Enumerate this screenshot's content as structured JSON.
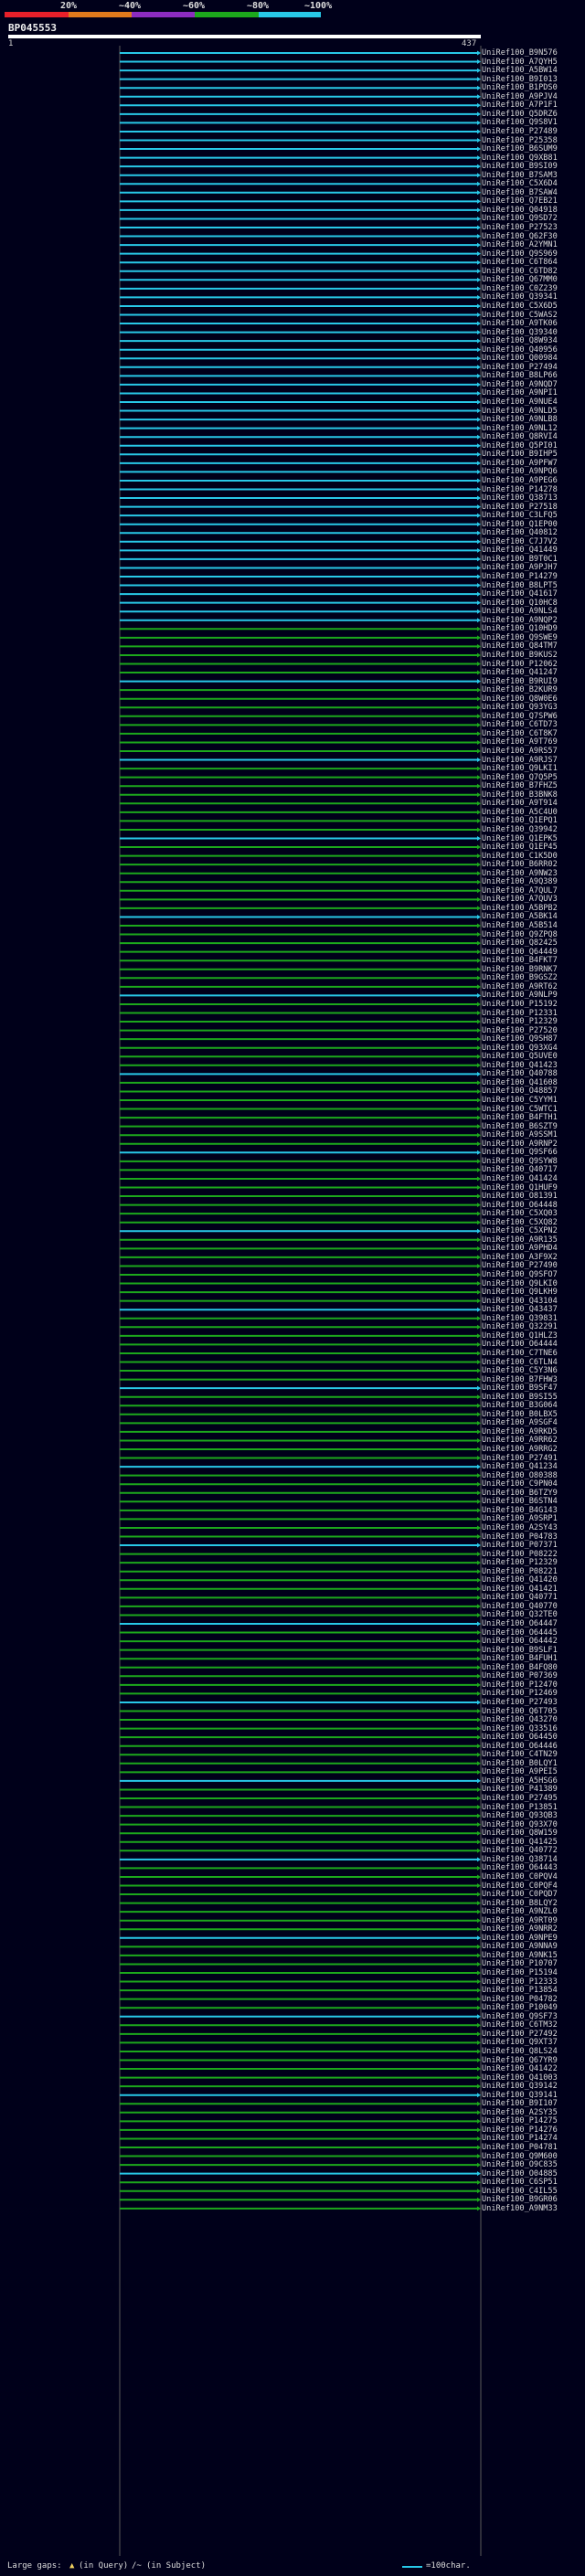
{
  "header": {
    "percent_scale": [
      "20%",
      "~40%",
      "~60%",
      "~80%",
      "~100%"
    ],
    "color_scale": [
      "#e8202a",
      "#e07a1c",
      "#8c2cc0",
      "#1ca81c",
      "#28c8e8"
    ],
    "query_name": "BP045553",
    "start_tick": "1",
    "end_tick": "437"
  },
  "hits": [
    "UniRef100_B9N576",
    "UniRef100_A7QYH5",
    "UniRef100_A5BW14",
    "UniRef100_B9I013",
    "UniRef100_B1PDS0",
    "UniRef100_A9PJV4",
    "UniRef100_A7P1F1",
    "UniRef100_Q5DRZ6",
    "UniRef100_Q9S8V1",
    "UniRef100_P27489",
    "UniRef100_P25358",
    "UniRef100_B6SUM9",
    "UniRef100_Q9XB81",
    "UniRef100_B9SI09",
    "UniRef100_B7SAM3",
    "UniRef100_C5X6D4",
    "UniRef100_B7SAW4",
    "UniRef100_Q7EB21",
    "UniRef100_Q04918",
    "UniRef100_Q9SD72",
    "UniRef100_P27523",
    "UniRef100_Q62F30",
    "UniRef100_A2YMN1",
    "UniRef100_Q9S969",
    "UniRef100_C6T864",
    "UniRef100_C6TD82",
    "UniRef100_Q67MM0",
    "UniRef100_C0Z239",
    "UniRef100_Q39341",
    "UniRef100_C5X6D5",
    "UniRef100_C5WAS2",
    "UniRef100_A9TK06",
    "UniRef100_Q39340",
    "UniRef100_Q8W934",
    "UniRef100_Q40956",
    "UniRef100_Q00984",
    "UniRef100_P27494",
    "UniRef100_B8LP66",
    "UniRef100_A9NQD7",
    "UniRef100_A9NPI1",
    "UniRef100_A9NUE4",
    "UniRef100_A9NLD5",
    "UniRef100_A9NLB8",
    "UniRef100_A9NL12",
    "UniRef100_Q8RVI4",
    "UniRef100_Q5PI01",
    "UniRef100_B9IHP5",
    "UniRef100_A9PFW7",
    "UniRef100_A9NPQ6",
    "UniRef100_A9PEG6",
    "UniRef100_P14278",
    "UniRef100_Q38713",
    "UniRef100_P27518",
    "UniRef100_C3LFQ5",
    "UniRef100_Q1EP00",
    "UniRef100_Q40812",
    "UniRef100_C7J7V2",
    "UniRef100_Q41449",
    "UniRef100_B9T0C1",
    "UniRef100_A9PJH7",
    "UniRef100_P14279",
    "UniRef100_B8LPT5",
    "UniRef100_Q41617",
    "UniRef100_Q10HC8",
    "UniRef100_A9NLS4",
    "UniRef100_A9NQP2",
    "UniRef100_Q10HD9",
    "UniRef100_Q9SWE9",
    "UniRef100_Q84TM7",
    "UniRef100_B9KUS2",
    "UniRef100_P12062",
    "UniRef100_Q41247",
    "UniRef100_B9RUI9",
    "UniRef100_B2KUR9",
    "UniRef100_Q8W0E6",
    "UniRef100_Q93YG3",
    "UniRef100_Q7SPW6",
    "UniRef100_C6TD73",
    "UniRef100_C6T8K7",
    "UniRef100_A9T769",
    "UniRef100_A9RS57",
    "UniRef100_A9RJS7",
    "UniRef100_Q9LKI1",
    "UniRef100_Q7Q5P5",
    "UniRef100_B7FHZ5",
    "UniRef100_B3BNK8",
    "UniRef100_A9T914",
    "UniRef100_A5C4U0",
    "UniRef100_Q1EPQ1",
    "UniRef100_Q39942",
    "UniRef100_Q1EPK5",
    "UniRef100_Q1EP45",
    "UniRef100_C1K5D0",
    "UniRef100_B6RR02",
    "UniRef100_A9NW23",
    "UniRef100_A9Q389",
    "UniRef100_A7QUL7",
    "UniRef100_A7QUV3",
    "UniRef100_A5BPB2",
    "UniRef100_A5BK14",
    "UniRef100_A5B514",
    "UniRef100_Q9ZPQ8",
    "UniRef100_Q82425",
    "UniRef100_Q64449",
    "UniRef100_B4FKT7",
    "UniRef100_B9RNK7",
    "UniRef100_B9GSZ2",
    "UniRef100_A9RT62",
    "UniRef100_A9NLP9",
    "UniRef100_P15192",
    "UniRef100_P12331",
    "UniRef100_P12329",
    "UniRef100_P27520",
    "UniRef100_Q9SH87",
    "UniRef100_Q93XG4",
    "UniRef100_Q5UVE0",
    "UniRef100_Q41423",
    "UniRef100_Q40788",
    "UniRef100_Q41608",
    "UniRef100_O48857",
    "UniRef100_C5YYM1",
    "UniRef100_C5WTC1",
    "UniRef100_B4FTH1",
    "UniRef100_B6SZT9",
    "UniRef100_A9SSM1",
    "UniRef100_A9RNP2",
    "UniRef100_Q9SF66",
    "UniRef100_Q9SYW8",
    "UniRef100_Q40717",
    "UniRef100_Q41424",
    "UniRef100_Q1HUF9",
    "UniRef100_O81391",
    "UniRef100_O64448",
    "UniRef100_C5XQ03",
    "UniRef100_C5XQ82",
    "UniRef100_C5XPN2",
    "UniRef100_A9R135",
    "UniRef100_A9PHD4",
    "UniRef100_A3F9X2",
    "UniRef100_P27490",
    "UniRef100_Q9SFO7",
    "UniRef100_Q9LKI0",
    "UniRef100_Q9LKH9",
    "UniRef100_Q43104",
    "UniRef100_Q43437",
    "UniRef100_Q39831",
    "UniRef100_Q32291",
    "UniRef100_Q1HLZ3",
    "UniRef100_O64444",
    "UniRef100_C7TNE6",
    "UniRef100_C6TLN4",
    "UniRef100_C5Y3N6",
    "UniRef100_B7FHW3",
    "UniRef100_B9SF47",
    "UniRef100_B9SI55",
    "UniRef100_B3G064",
    "UniRef100_B0LBX5",
    "UniRef100_A9SGF4",
    "UniRef100_A9RKD5",
    "UniRef100_A9RR62",
    "UniRef100_A9RRG2",
    "UniRef100_P27491",
    "UniRef100_Q41234",
    "UniRef100_O80388",
    "UniRef100_C9PN04",
    "UniRef100_B6TZY9",
    "UniRef100_B6STN4",
    "UniRef100_B4G143",
    "UniRef100_A9SRP1",
    "UniRef100_A2SY43",
    "UniRef100_P04783",
    "UniRef100_P07371",
    "UniRef100_P08222",
    "UniRef100_P12329",
    "UniRef100_P08221",
    "UniRef100_Q41420",
    "UniRef100_Q41421",
    "UniRef100_Q40771",
    "UniRef100_Q40770",
    "UniRef100_Q32TE0",
    "UniRef100_O64447",
    "UniRef100_O64445",
    "UniRef100_O64442",
    "UniRef100_B9SLF1",
    "UniRef100_B4FUH1",
    "UniRef100_B4FQ80",
    "UniRef100_P07369",
    "UniRef100_P12470",
    "UniRef100_P12469",
    "UniRef100_P27493",
    "UniRef100_Q6T705",
    "UniRef100_Q43270",
    "UniRef100_Q33516",
    "UniRef100_O64450",
    "UniRef100_O64446",
    "UniRef100_C4TN29",
    "UniRef100_B0LQY1",
    "UniRef100_A9PEI5",
    "UniRef100_A5HSG6",
    "UniRef100_P41389",
    "UniRef100_P27495",
    "UniRef100_P13851",
    "UniRef100_Q93QB3",
    "UniRef100_Q93X70",
    "UniRef100_Q8W159",
    "UniRef100_Q41425",
    "UniRef100_Q40772",
    "UniRef100_Q38714",
    "UniRef100_O64443",
    "UniRef100_C0PQV4",
    "UniRef100_C0PQF4",
    "UniRef100_C0PQD7",
    "UniRef100_B8LQY2",
    "UniRef100_A9NZL0",
    "UniRef100_A9RT09",
    "UniRef100_A9NRR2",
    "UniRef100_A9NPE9",
    "UniRef100_A9NNA9",
    "UniRef100_A9NK15",
    "UniRef100_P10707",
    "UniRef100_P15194",
    "UniRef100_P12333",
    "UniRef100_P13854",
    "UniRef100_P04782",
    "UniRef100_P10049",
    "UniRef100_Q9SF73",
    "UniRef100_C6TM32",
    "UniRef100_P27492",
    "UniRef100_Q9XT37",
    "UniRef100_Q8LS24",
    "UniRef100_Q67YR9",
    "UniRef100_Q41422",
    "UniRef100_Q41003",
    "UniRef100_Q39142",
    "UniRef100_Q39141",
    "UniRef100_B9I107",
    "UniRef100_A2SY35",
    "UniRef100_P14275",
    "UniRef100_P14276",
    "UniRef100_P14274",
    "UniRef100_P04781",
    "UniRef100_Q9M600",
    "UniRef100_O9C835",
    "UniRef100_O04885",
    "UniRef100_C6SP51",
    "UniRef100_C4IL55",
    "UniRef100_B9GR06",
    "UniRef100_A9NM33"
  ],
  "footer": {
    "large_gaps_label": "Large gaps:",
    "in_query_label": "(in Query)",
    "in_subject_label": "(in Subject)",
    "scale_label": "=100char."
  }
}
